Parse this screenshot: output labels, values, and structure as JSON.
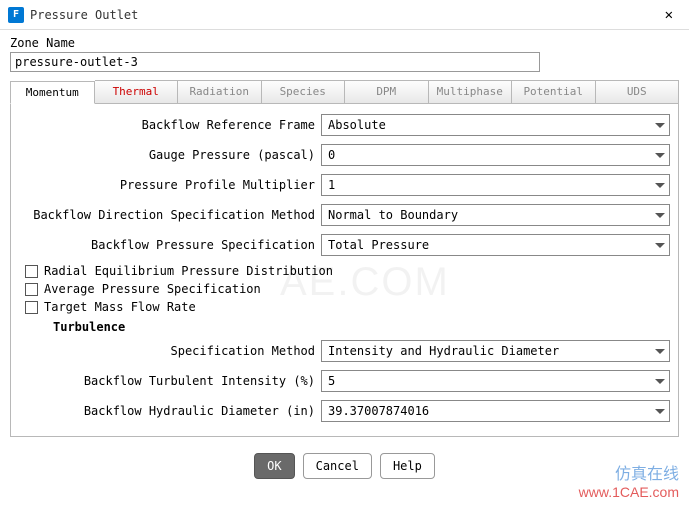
{
  "window": {
    "title": "Pressure Outlet"
  },
  "zone": {
    "label": "Zone Name",
    "value": "pressure-outlet-3"
  },
  "tabs": [
    {
      "label": "Momentum"
    },
    {
      "label": "Thermal"
    },
    {
      "label": "Radiation"
    },
    {
      "label": "Species"
    },
    {
      "label": "DPM"
    },
    {
      "label": "Multiphase"
    },
    {
      "label": "Potential"
    },
    {
      "label": "UDS"
    }
  ],
  "fields": {
    "ref_frame": {
      "label": "Backflow Reference Frame",
      "value": "Absolute"
    },
    "gauge": {
      "label": "Gauge Pressure (pascal)",
      "value": "0"
    },
    "mult": {
      "label": "Pressure Profile Multiplier",
      "value": "1"
    },
    "dir": {
      "label": "Backflow Direction Specification Method",
      "value": "Normal to Boundary"
    },
    "press_spec": {
      "label": "Backflow Pressure Specification",
      "value": "Total Pressure"
    }
  },
  "checks": {
    "radial": "Radial Equilibrium Pressure Distribution",
    "avg": "Average Pressure Specification",
    "target": "Target Mass Flow Rate"
  },
  "turb": {
    "header": "Turbulence",
    "spec": {
      "label": "Specification Method",
      "value": "Intensity and Hydraulic Diameter"
    },
    "intens": {
      "label": "Backflow Turbulent Intensity (%)",
      "value": "5"
    },
    "diam": {
      "label": "Backflow Hydraulic Diameter (in)",
      "value": "39.37007874016"
    }
  },
  "buttons": {
    "ok": "OK",
    "cancel": "Cancel",
    "help": "Help"
  },
  "watermark": {
    "big": "AE.COM",
    "cn": "仿真在线",
    "url": "www.1CAE.com"
  }
}
